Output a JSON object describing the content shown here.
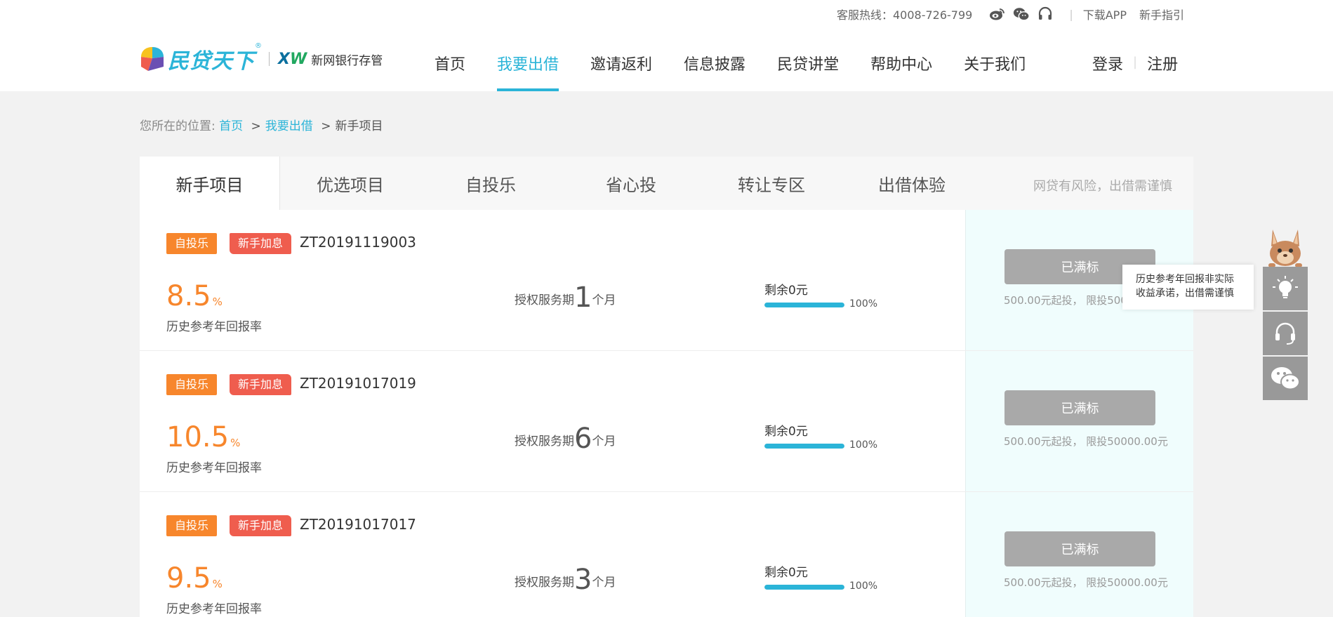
{
  "topbar": {
    "hotline": "客服热线：4008-726-799",
    "links": [
      "下载APP",
      "新手指引"
    ],
    "icons": [
      "weibo-icon",
      "wechat-icon",
      "headset-icon"
    ]
  },
  "logo": {
    "brand": "民贷天下",
    "registered": "®",
    "xw": "XW",
    "bank": "新网银行存管"
  },
  "nav": {
    "items": [
      "首页",
      "我要出借",
      "邀请返利",
      "信息披露",
      "民贷讲堂",
      "帮助中心",
      "关于我们"
    ],
    "active_index": 1,
    "login": "登录",
    "register": "注册"
  },
  "breadcrumb": {
    "prefix": "您所在的位置:",
    "home": "首页",
    "section": "我要出借",
    "current": "新手项目",
    "sep": ">"
  },
  "tabs": {
    "items": [
      "新手项目",
      "优选项目",
      "自投乐",
      "省心投",
      "转让专区",
      "出借体验"
    ],
    "active_index": 0,
    "risk_notice": "网贷有风险，出借需谨慎"
  },
  "projects": [
    {
      "tag1": "自投乐",
      "tag2": "新手加息",
      "code": "ZT20191119003",
      "rate": "8.5",
      "rate_unit": "%",
      "rate_label": "历史参考年回报率",
      "term_prefix": "授权服务期",
      "term": "1",
      "term_unit": "个月",
      "remain": "剩余0元",
      "progress": 100,
      "progress_label": "100%",
      "button": "已满标",
      "limit": "500.00元起投， 限投50000.00元"
    },
    {
      "tag1": "自投乐",
      "tag2": "新手加息",
      "code": "ZT20191017019",
      "rate": "10.5",
      "rate_unit": "%",
      "rate_label": "历史参考年回报率",
      "term_prefix": "授权服务期",
      "term": "6",
      "term_unit": "个月",
      "remain": "剩余0元",
      "progress": 100,
      "progress_label": "100%",
      "button": "已满标",
      "limit": "500.00元起投， 限投50000.00元"
    },
    {
      "tag1": "自投乐",
      "tag2": "新手加息",
      "code": "ZT20191017017",
      "rate": "9.5",
      "rate_unit": "%",
      "rate_label": "历史参考年回报率",
      "term_prefix": "授权服务期",
      "term": "3",
      "term_unit": "个月",
      "remain": "剩余0元",
      "progress": 100,
      "progress_label": "100%",
      "button": "已满标",
      "limit": "500.00元起投， 限投50000.00元"
    }
  ],
  "float": {
    "tooltip_line1": "历史参考年回报非实际",
    "tooltip_line2": "收益承诺，出借需谨慎",
    "buttons": [
      "lightbulb-icon",
      "headset-icon",
      "wechat-icon"
    ]
  },
  "colors": {
    "accent": "#2bb4d8",
    "orange": "#f7862c",
    "red_tag": "#ef5d4e",
    "button_gray": "#a9a9a9"
  }
}
